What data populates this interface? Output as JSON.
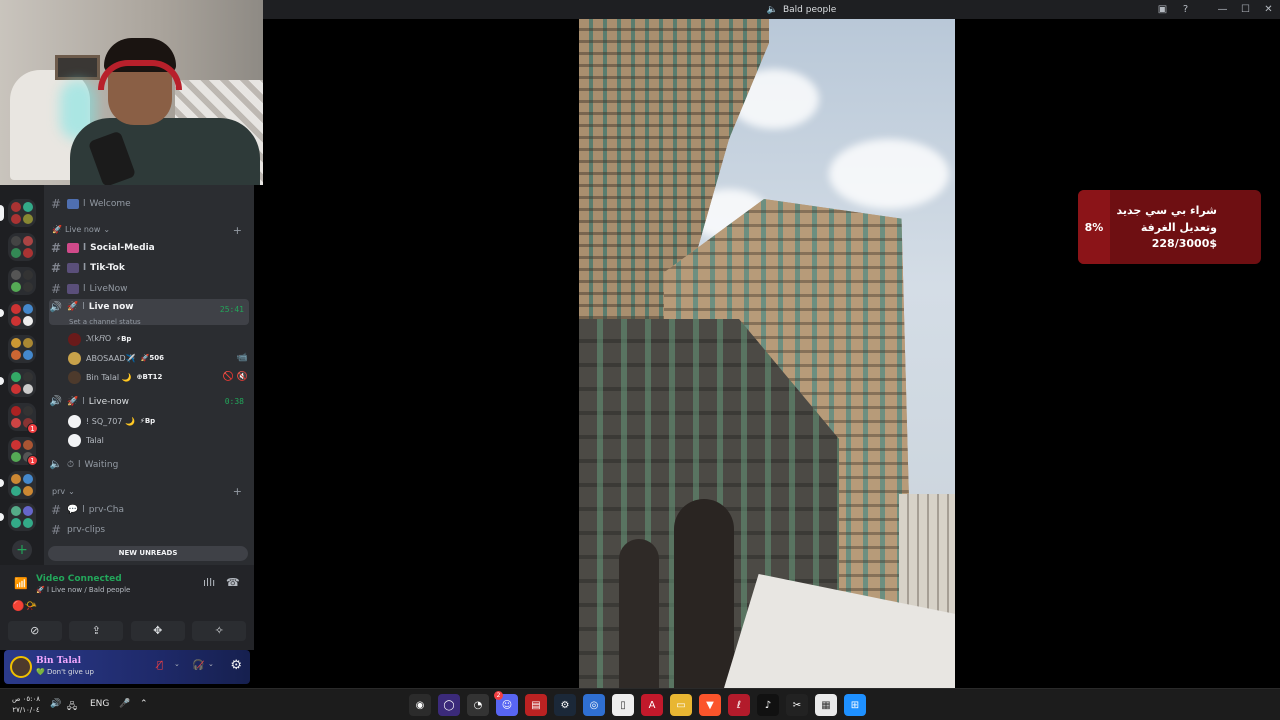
{
  "window": {
    "title": "Bald people"
  },
  "channels": {
    "welcome": "Welcome",
    "category_live": "Live now",
    "social_media": "Social-Media",
    "tiktok": "Tik-Tok",
    "livenow_text": "LiveNow",
    "voice_live_now": {
      "name": "Live now",
      "timer": "25:41",
      "status": "Set a channel status"
    },
    "users_live_now": [
      {
        "name": "ℳk𝑅O",
        "tag": "⚡Bp",
        "right": ""
      },
      {
        "name": "ABOSAAD✈️",
        "tag": "🚀506",
        "right": "📹"
      },
      {
        "name": "Bin Talal 🌙",
        "tag": "⊕BT12",
        "right": "🚫 🔇"
      }
    ],
    "voice_live_now2": {
      "name": "Live-now",
      "timer": "0:38"
    },
    "users_live_now2": [
      {
        "name": "! SQ_707 🌙",
        "tag": "⚡Bp",
        "right": ""
      },
      {
        "name": "Talal",
        "tag": "",
        "right": ""
      }
    ],
    "waiting": "Waiting",
    "category_prv": "prv",
    "prv_chat": "prv-Cha",
    "prv_clips": "prv-clips",
    "new_unreads": "NEW UNREADS"
  },
  "voice_panel": {
    "title": "Video Connected",
    "subtitle": "Live now / Bald people"
  },
  "user_panel": {
    "name": "Bin Talal",
    "status": "Don't give up"
  },
  "donation": {
    "percent": "8%",
    "text": "شراء بي سي جديد وتعديل الغرفة",
    "amount": "228/3000$"
  },
  "taskbar": {
    "time": "٠٥:٠٨ ص",
    "date": "٢٧/١٠/٠٤",
    "language": "ENG",
    "discord_badge": "2",
    "apps": [
      "obs-icon",
      "circle-app-icon",
      "clock-app-icon",
      "discord-icon",
      "media-icon",
      "steam-icon",
      "chrome-icon",
      "file-icon",
      "adobe-icon",
      "folder-icon",
      "brave-icon",
      "app-red-icon",
      "music-icon",
      "capcut-icon",
      "store-icon",
      "windows-icon"
    ]
  },
  "colors": {
    "green": "#23a55a",
    "donation_bg": "#6e0f12",
    "sidebar": "#2b2d31",
    "rail": "#1e1f22"
  }
}
